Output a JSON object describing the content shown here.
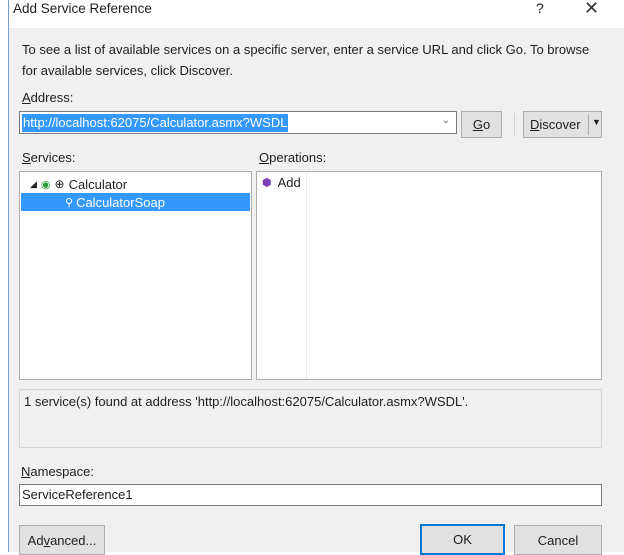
{
  "dialog": {
    "title": "Add Service Reference",
    "help_label": "?",
    "close_label": "✕"
  },
  "description": {
    "line1": "To see a list of available services on a specific server, enter a service URL and click Go. To browse",
    "line2": "for available services, click Discover."
  },
  "address": {
    "label_u": "A",
    "label_rest": "ddress:",
    "value": "http://localhost:62075/Calculator.asmx?WSDL"
  },
  "buttons": {
    "go_u": "G",
    "go_rest": "o",
    "discover_u": "D",
    "discover_rest": "iscover",
    "advanced_a": "Ad",
    "advanced_u": "v",
    "advanced_rest": "anced...",
    "ok": "OK",
    "cancel": "Cancel"
  },
  "services": {
    "label_u": "S",
    "label_rest": "ervices:",
    "tree": [
      {
        "label": "Calculator"
      },
      {
        "label": "CalculatorSoap"
      }
    ]
  },
  "operations": {
    "label_u": "O",
    "label_rest": "perations:",
    "items": [
      {
        "label": "Add"
      }
    ]
  },
  "status": {
    "text": "1 service(s) found at address 'http://localhost:62075/Calculator.asmx?WSDL'."
  },
  "namespace": {
    "label_u": "N",
    "label_rest": "amespace:",
    "value": "ServiceReference1"
  },
  "colors": {
    "selection": "#3399ff",
    "background": "#f0f0f0"
  }
}
